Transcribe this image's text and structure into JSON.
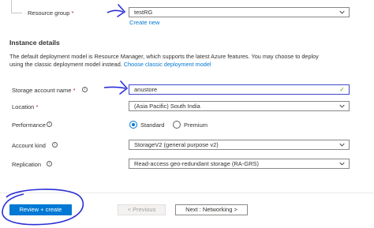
{
  "resource_group": {
    "label": "Resource group",
    "required_mark": "*",
    "value": "testRG",
    "create_new": "Create new"
  },
  "instance_details": {
    "heading": "Instance details",
    "description_line1": "The default deployment model is Resource Manager, which supports the latest Azure features. You may choose to deploy",
    "description_line2_prefix": "using the classic deployment model instead.",
    "classic_link": "Choose classic deployment model"
  },
  "fields": {
    "storage_account_name": {
      "label": "Storage account name",
      "required_mark": "*",
      "value": "anustore",
      "valid_icon": "checkmark-icon"
    },
    "location": {
      "label": "Location",
      "required_mark": "*",
      "value": "(Asia Pacific) South India"
    },
    "performance": {
      "label": "Performance",
      "options": [
        "Standard",
        "Premium"
      ],
      "selected": "Standard"
    },
    "account_kind": {
      "label": "Account kind",
      "value": "StorageV2 (general purpose v2)"
    },
    "replication": {
      "label": "Replication",
      "value": "Read-access geo-redundant storage (RA-GRS)"
    }
  },
  "footer": {
    "review_create": "Review + create",
    "previous": "< Previous",
    "next": "Next : Networking >"
  },
  "colors": {
    "accent": "#0078d4",
    "annotation_ink": "#2b2fd6",
    "required": "#a4262c",
    "valid": "#57a300"
  }
}
